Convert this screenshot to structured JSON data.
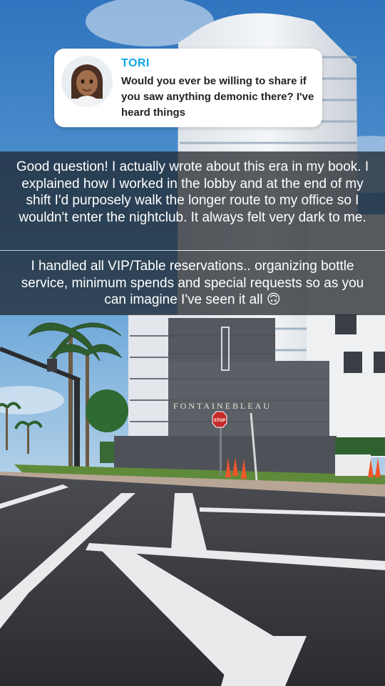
{
  "reply": {
    "name": "TORI",
    "message": "Would you ever be willing to share if you saw anything demonic there? I've heard things"
  },
  "captions": [
    "Good question! I actually wrote about this era in my book. I explained how I worked in the lobby and at the end of my shift I'd purposely walk the longer route to my office so I wouldn't enter the nightclub. It always felt very dark to me.",
    "I handled all VIP/Table reservations.. organizing bottle service, minimum spends and special requests so as you can imagine I've seen it all 🙃"
  ],
  "scene": {
    "building_sign": "FONTAINEBLEAU",
    "stop_sign": "STOP"
  },
  "colors": {
    "sky": "#3f86c7",
    "reply_name": "#0ea5e9",
    "caption_bg": "#1c2026"
  },
  "icons": {
    "avatar": "bitmoji-avatar"
  }
}
